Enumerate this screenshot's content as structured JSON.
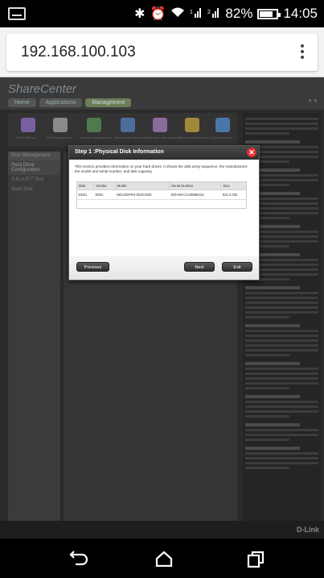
{
  "status_bar": {
    "battery": "82%",
    "time": "14:05",
    "icons": [
      "notification-box-icon",
      "bluetooth-icon",
      "alarm-icon",
      "wifi-icon",
      "signal-1-icon",
      "signal-2-icon",
      "battery-icon"
    ]
  },
  "browser": {
    "url": "192.168.100.103"
  },
  "page": {
    "brand": "ShareCenter",
    "tabs": [
      "Home",
      "Applications",
      "Management"
    ],
    "apps": [
      "Setup Wizard",
      "Disk Management",
      "Account Management",
      "Network Management",
      "Application Management",
      "System Management",
      "System Status"
    ],
    "sidebar_head": "Disk Management",
    "sidebar_items": [
      "Hard Drive Configuration",
      "S.M.A.R.T Test",
      "Scan Disk"
    ],
    "footer_logo": "D-Link"
  },
  "dialog": {
    "title": "Step 1 :Physical Disk Information",
    "description": "This section provides information on your hard drives. It shows the disk array sequence, the manufacturer, the model and serial number, and disk capacity.",
    "table": {
      "headers": [
        "Disk",
        "Vendor",
        "Model",
        "Serial Number",
        "Size"
      ],
      "rows": [
        [
          "Disk1",
          "WDC",
          "WD10EFRX-68JCSN0",
          "WD-WCC1U0885416",
          "931.5 GB"
        ]
      ]
    },
    "buttons": {
      "previous": "Previous",
      "next": "Next",
      "exit": "Exit"
    },
    "close_glyph": "✕"
  },
  "colors": {
    "dialog_title_bg": "#3a3a3a",
    "close_button": "#e03030",
    "page_bg": "#2b2b2b",
    "active_tab": "#6d7d5a"
  }
}
